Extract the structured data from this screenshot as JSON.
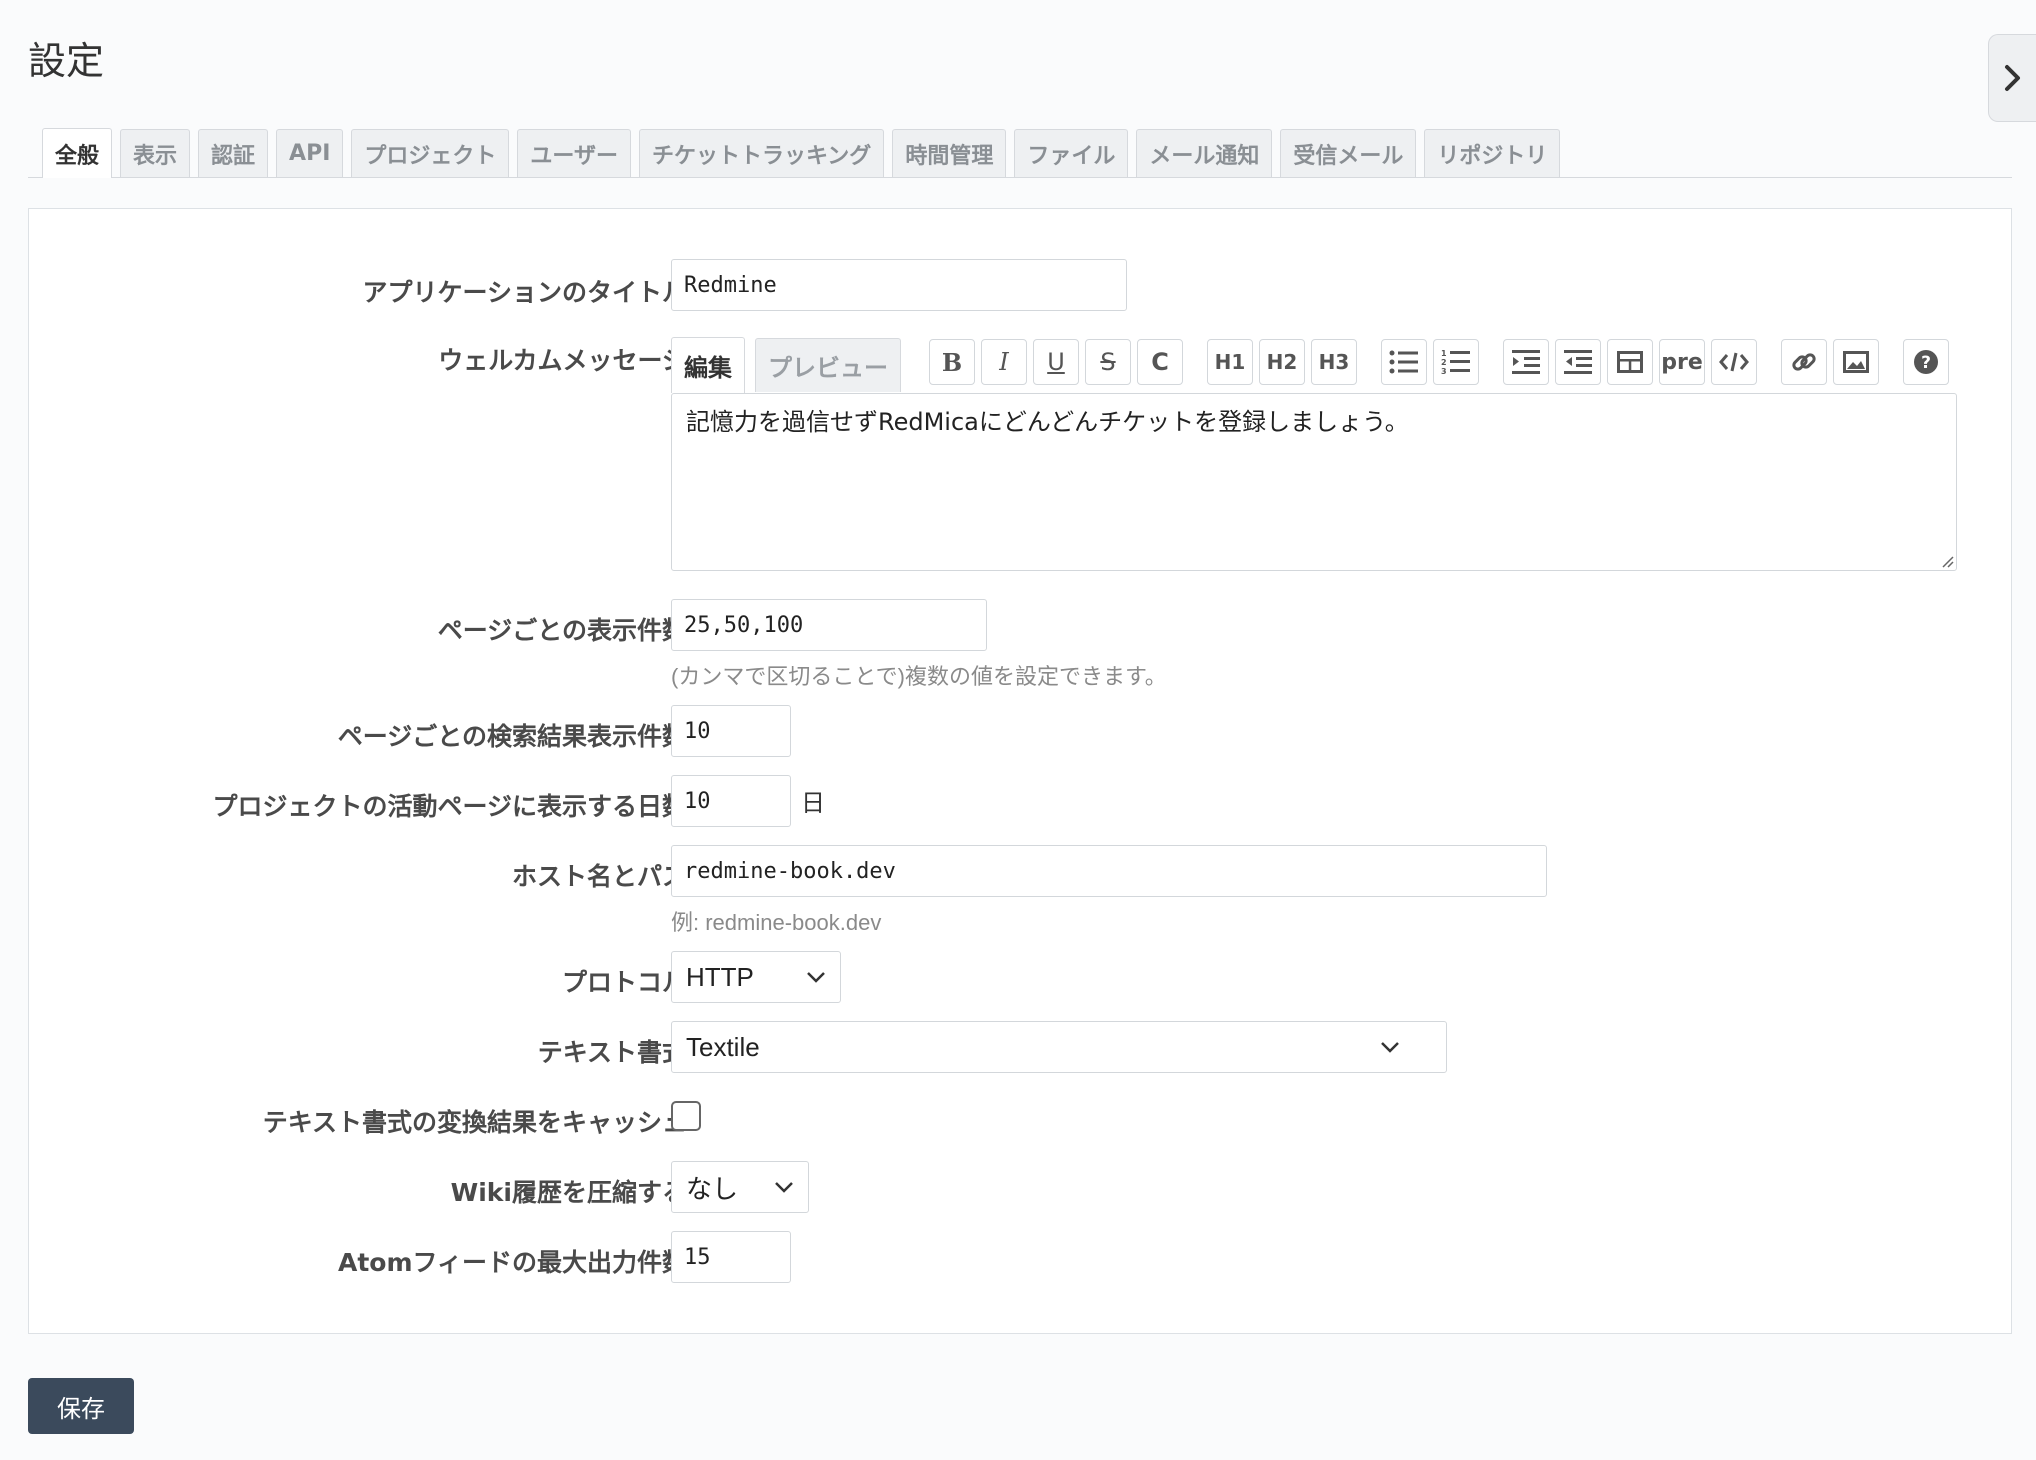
{
  "page": {
    "title": "設定"
  },
  "tabs": [
    "全般",
    "表示",
    "認証",
    "API",
    "プロジェクト",
    "ユーザー",
    "チケットトラッキング",
    "時間管理",
    "ファイル",
    "メール通知",
    "受信メール",
    "リポジトリ"
  ],
  "active_tab": "全般",
  "form": {
    "app_title": {
      "label": "アプリケーションのタイトル",
      "value": "Redmine"
    },
    "welcome": {
      "label": "ウェルカムメッセージ",
      "edit_tab": "編集",
      "preview_tab": "プレビュー",
      "toolbar": {
        "bold": "B",
        "italic": "I",
        "underline": "U",
        "strike": "S",
        "code": "C",
        "h1": "H1",
        "h2": "H2",
        "h3": "H3",
        "pre": "pre"
      },
      "value": "記憶力を過信せずRedMicaにどんどんチケットを登録しましょう。"
    },
    "per_page": {
      "label": "ページごとの表示件数",
      "value": "25,50,100",
      "hint": "(カンマで区切ることで)複数の値を設定できます。"
    },
    "search_per_page": {
      "label": "ページごとの検索結果表示件数",
      "value": "10"
    },
    "activity_days": {
      "label": "プロジェクトの活動ページに表示する日数",
      "value": "10",
      "unit": "日"
    },
    "host_name": {
      "label": "ホスト名とパス",
      "value": "redmine-book.dev",
      "hint": "例: redmine-book.dev"
    },
    "protocol": {
      "label": "プロトコル",
      "value": "HTTP"
    },
    "text_format": {
      "label": "テキスト書式",
      "value": "Textile"
    },
    "cache_format": {
      "label": "テキスト書式の変換結果をキャッシュ",
      "checked": false
    },
    "wiki_compress": {
      "label": "Wiki履歴を圧縮する",
      "value": "なし"
    },
    "atom_limit": {
      "label": "Atomフィードの最大出力件数",
      "value": "15"
    }
  },
  "save_label": "保存",
  "icons": [
    "chevron-right-icon",
    "chevron-down-icon",
    "bullet-list-icon",
    "numbered-list-icon",
    "indent-icon",
    "outdent-icon",
    "table-icon",
    "code-icon",
    "link-icon",
    "image-icon",
    "help-icon"
  ]
}
